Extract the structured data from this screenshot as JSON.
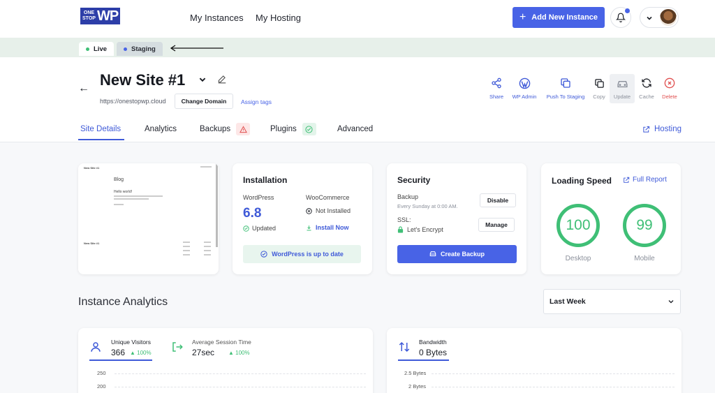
{
  "logo": {
    "small_top": "ONE",
    "small_bottom": "STOP",
    "big": "WP"
  },
  "nav": {
    "instances": "My Instances",
    "hosting": "My Hosting",
    "add_instance": "Add New Instance"
  },
  "env_tabs": {
    "live": "Live",
    "staging": "Staging",
    "live_color": "#3fbf76",
    "staging_color": "#4863e6"
  },
  "site": {
    "title": "New Site #1",
    "url": "https://onestopwp.cloud",
    "change_domain": "Change Domain",
    "assign_tags": "Assign tags"
  },
  "actions": {
    "share": "Share",
    "wp_admin": "WP Admin",
    "push_staging": "Push To Staging",
    "copy": "Copy",
    "update": "Update",
    "cache": "Cache",
    "delete": "Delete"
  },
  "tabs": {
    "site_details": "Site Details",
    "analytics": "Analytics",
    "backups": "Backups",
    "plugins": "Plugins",
    "advanced": "Advanced",
    "hosting": "Hosting"
  },
  "preview": {
    "site_name": "New Site #1",
    "blog_heading": "Blog",
    "post_title": "Hello world!"
  },
  "installation": {
    "title": "Installation",
    "wordpress_label": "WordPress",
    "wordpress_version": "6.8",
    "wordpress_status": "Updated",
    "woo_label": "WooCommerce",
    "woo_status": "Not Installed",
    "woo_install": "Install Now",
    "uptodate": "WordPress is up to date"
  },
  "security": {
    "title": "Security",
    "backup_label": "Backup",
    "backup_schedule": "Every Sunday at 0:00 AM.",
    "disable": "Disable",
    "ssl_label": "SSL:",
    "ssl_value": "Let's Encrypt",
    "manage": "Manage",
    "create_backup": "Create Backup"
  },
  "speed": {
    "title": "Loading Speed",
    "full_report": "Full Report",
    "desktop_score": "100",
    "desktop_label": "Desktop",
    "mobile_score": "99",
    "mobile_label": "Mobile"
  },
  "analytics": {
    "title": "Instance Analytics",
    "period": "Last Week",
    "unique_visitors_label": "Unique Visitors",
    "unique_visitors_value": "366",
    "unique_visitors_change": "100%",
    "session_label": "Average Session Time",
    "session_value": "27sec",
    "session_change": "100%",
    "bandwidth_label": "Bandwidth",
    "bandwidth_value": "0 Bytes",
    "visitors_axis": [
      "250",
      "200"
    ],
    "bandwidth_axis": [
      "2.5 Bytes",
      "2 Bytes"
    ]
  }
}
